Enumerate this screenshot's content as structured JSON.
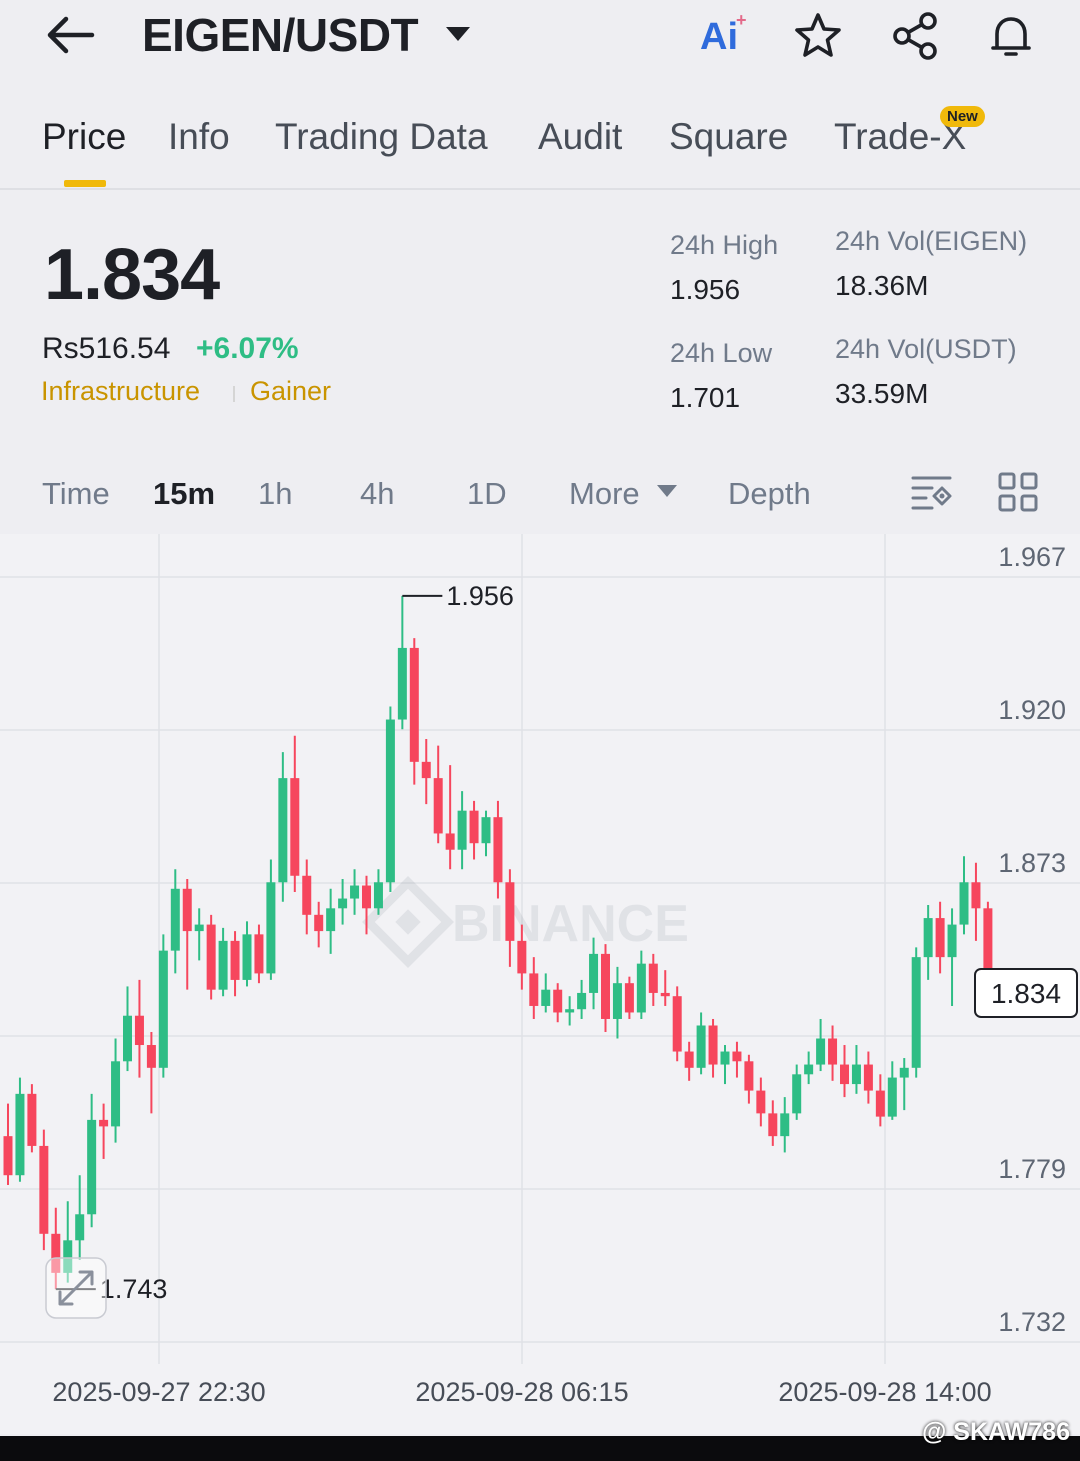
{
  "header": {
    "pair": "EIGEN/USDT",
    "ai_label": "Ai"
  },
  "tabs": [
    {
      "label": "Price"
    },
    {
      "label": "Info"
    },
    {
      "label": "Trading Data"
    },
    {
      "label": "Audit"
    },
    {
      "label": "Square"
    },
    {
      "label": "Trade-X"
    }
  ],
  "new_badge": "New",
  "ticker": {
    "last_price": "1.834",
    "fiat_price": "Rs516.54",
    "change_pct": "+6.07%",
    "tags": [
      "Infrastructure",
      "Gainer"
    ]
  },
  "stats": {
    "high_label": "24h High",
    "high_value": "1.956",
    "low_label": "24h Low",
    "low_value": "1.701",
    "vol_base_label": "24h Vol(EIGEN)",
    "vol_base_value": "18.36M",
    "vol_quote_label": "24h Vol(USDT)",
    "vol_quote_value": "33.59M"
  },
  "chart_tabs": [
    {
      "label": "Time"
    },
    {
      "label": "15m"
    },
    {
      "label": "1h"
    },
    {
      "label": "4h"
    },
    {
      "label": "1D"
    },
    {
      "label": "More"
    },
    {
      "label": "Depth"
    }
  ],
  "colors": {
    "up": "#2ebd85",
    "down": "#f6465d",
    "accent": "#f0b90b"
  },
  "icons": [
    "back-arrow-icon",
    "caret-down-icon",
    "star-icon",
    "share-icon",
    "bell-icon",
    "indicator-settings-icon",
    "layout-grid-icon",
    "expand-icon"
  ],
  "watermark": "BINANCE",
  "credit": "@ SKAW786",
  "chart_data": {
    "type": "candlestick",
    "interval": "15m",
    "ylim": [
      1.72,
      1.975
    ],
    "y_ticks": [
      "1.967",
      "1.920",
      "1.873",
      "1.779",
      "1.732"
    ],
    "x_ticks": [
      "2025-09-27 22:30",
      "2025-09-28 06:15",
      "2025-09-28 14:00"
    ],
    "high_marker": "1.956",
    "low_marker": "1.743",
    "current_price_tag": "1.834",
    "candles": [
      [
        1.79,
        1.778,
        1.8,
        1.775
      ],
      [
        1.778,
        1.803,
        1.808,
        1.776
      ],
      [
        1.803,
        1.787,
        1.806,
        1.785
      ],
      [
        1.787,
        1.76,
        1.792,
        1.755
      ],
      [
        1.76,
        1.748,
        1.768,
        1.743
      ],
      [
        1.748,
        1.758,
        1.77,
        1.745
      ],
      [
        1.758,
        1.766,
        1.778,
        1.752
      ],
      [
        1.766,
        1.795,
        1.803,
        1.762
      ],
      [
        1.795,
        1.793,
        1.8,
        1.783
      ],
      [
        1.793,
        1.813,
        1.82,
        1.788
      ],
      [
        1.813,
        1.827,
        1.836,
        1.81
      ],
      [
        1.827,
        1.818,
        1.838,
        1.808
      ],
      [
        1.818,
        1.811,
        1.822,
        1.797
      ],
      [
        1.811,
        1.847,
        1.852,
        1.808
      ],
      [
        1.847,
        1.866,
        1.872,
        1.84
      ],
      [
        1.866,
        1.853,
        1.869,
        1.835
      ],
      [
        1.853,
        1.855,
        1.86,
        1.844
      ],
      [
        1.855,
        1.835,
        1.858,
        1.832
      ],
      [
        1.835,
        1.85,
        1.854,
        1.833
      ],
      [
        1.85,
        1.838,
        1.853,
        1.833
      ],
      [
        1.838,
        1.852,
        1.856,
        1.836
      ],
      [
        1.852,
        1.84,
        1.855,
        1.837
      ],
      [
        1.84,
        1.868,
        1.875,
        1.838
      ],
      [
        1.868,
        1.9,
        1.908,
        1.862
      ],
      [
        1.9,
        1.87,
        1.913,
        1.865
      ],
      [
        1.87,
        1.858,
        1.875,
        1.852
      ],
      [
        1.858,
        1.853,
        1.862,
        1.848
      ],
      [
        1.853,
        1.86,
        1.866,
        1.846
      ],
      [
        1.86,
        1.863,
        1.869,
        1.855
      ],
      [
        1.863,
        1.867,
        1.872,
        1.858
      ],
      [
        1.867,
        1.86,
        1.87,
        1.852
      ],
      [
        1.86,
        1.868,
        1.872,
        1.858
      ],
      [
        1.868,
        1.918,
        1.922,
        1.865
      ],
      [
        1.918,
        1.94,
        1.956,
        1.915
      ],
      [
        1.94,
        1.905,
        1.943,
        1.898
      ],
      [
        1.905,
        1.9,
        1.912,
        1.892
      ],
      [
        1.9,
        1.883,
        1.91,
        1.88
      ],
      [
        1.883,
        1.878,
        1.904,
        1.872
      ],
      [
        1.878,
        1.89,
        1.896,
        1.872
      ],
      [
        1.89,
        1.88,
        1.893,
        1.875
      ],
      [
        1.88,
        1.888,
        1.89,
        1.876
      ],
      [
        1.888,
        1.868,
        1.893,
        1.863
      ],
      [
        1.868,
        1.85,
        1.872,
        1.842
      ],
      [
        1.85,
        1.84,
        1.855,
        1.835
      ],
      [
        1.84,
        1.83,
        1.845,
        1.826
      ],
      [
        1.83,
        1.835,
        1.84,
        1.828
      ],
      [
        1.835,
        1.828,
        1.837,
        1.825
      ],
      [
        1.828,
        1.829,
        1.833,
        1.824
      ],
      [
        1.829,
        1.834,
        1.838,
        1.826
      ],
      [
        1.834,
        1.846,
        1.851,
        1.829
      ],
      [
        1.846,
        1.826,
        1.849,
        1.822
      ],
      [
        1.826,
        1.837,
        1.842,
        1.82
      ],
      [
        1.837,
        1.828,
        1.839,
        1.826
      ],
      [
        1.828,
        1.843,
        1.847,
        1.826
      ],
      [
        1.843,
        1.834,
        1.846,
        1.83
      ],
      [
        1.834,
        1.833,
        1.841,
        1.83
      ],
      [
        1.833,
        1.816,
        1.836,
        1.813
      ],
      [
        1.816,
        1.811,
        1.819,
        1.807
      ],
      [
        1.811,
        1.824,
        1.828,
        1.809
      ],
      [
        1.824,
        1.812,
        1.826,
        1.808
      ],
      [
        1.812,
        1.816,
        1.818,
        1.806
      ],
      [
        1.816,
        1.813,
        1.819,
        1.808
      ],
      [
        1.813,
        1.804,
        1.815,
        1.8
      ],
      [
        1.804,
        1.797,
        1.808,
        1.793
      ],
      [
        1.797,
        1.79,
        1.801,
        1.787
      ],
      [
        1.79,
        1.797,
        1.802,
        1.785
      ],
      [
        1.797,
        1.809,
        1.812,
        1.795
      ],
      [
        1.809,
        1.812,
        1.816,
        1.806
      ],
      [
        1.812,
        1.82,
        1.826,
        1.81
      ],
      [
        1.82,
        1.812,
        1.824,
        1.807
      ],
      [
        1.812,
        1.806,
        1.818,
        1.802
      ],
      [
        1.806,
        1.812,
        1.818,
        1.803
      ],
      [
        1.812,
        1.804,
        1.816,
        1.8
      ],
      [
        1.804,
        1.796,
        1.809,
        1.793
      ],
      [
        1.796,
        1.808,
        1.813,
        1.795
      ],
      [
        1.808,
        1.811,
        1.814,
        1.798
      ],
      [
        1.811,
        1.845,
        1.848,
        1.808
      ],
      [
        1.845,
        1.857,
        1.861,
        1.838
      ],
      [
        1.857,
        1.845,
        1.862,
        1.84
      ],
      [
        1.845,
        1.855,
        1.86,
        1.83
      ],
      [
        1.855,
        1.868,
        1.876,
        1.852
      ],
      [
        1.868,
        1.86,
        1.874,
        1.85
      ],
      [
        1.86,
        1.834,
        1.862,
        1.832
      ]
    ]
  }
}
